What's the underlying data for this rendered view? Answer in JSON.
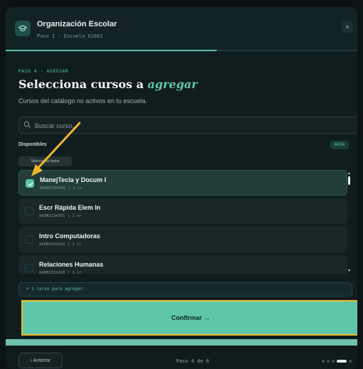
{
  "header": {
    "title": "Organización Escolar",
    "subtitle": "Paso I · Escuela 62661",
    "close_label": "×",
    "progress_fraction": 0.6
  },
  "step": {
    "label": "PASO 4 · AGREGAR",
    "title_prefix": "Selecciona cursos a ",
    "title_emphasis": "agregar",
    "description": "Cursos del catálogo no activos en tu escuela."
  },
  "search": {
    "placeholder": "Buscar curso...",
    "value": ""
  },
  "available": {
    "label": "Disponibles",
    "count": "6634",
    "select_all_label": "Seleccionar todos"
  },
  "courses": [
    {
      "name": "ManejTecla y Docum I",
      "code": "AADM1334100 | 1 cr",
      "selected": true
    },
    {
      "name": "Escr Rápida Elem In",
      "code": "AADM1334101 | 1 cr",
      "selected": false
    },
    {
      "name": "Intro Computadoras",
      "code": "AADM1334102 | 1 cr",
      "selected": false
    },
    {
      "name": "Relaciones Humanas",
      "code": "AADM1334103 | 1 cr",
      "selected": false
    }
  ],
  "summary": "+ 1 curso para agregar",
  "confirm_label": "Confirmar →",
  "footer": {
    "prev_label": "‹  Anterior",
    "page_indicator": "Paso 4 de 6",
    "dots": [
      false,
      false,
      false,
      true,
      false
    ]
  },
  "colors": {
    "accent": "#57c4a7",
    "highlight": "#f0b826",
    "background": "#101d1f"
  }
}
